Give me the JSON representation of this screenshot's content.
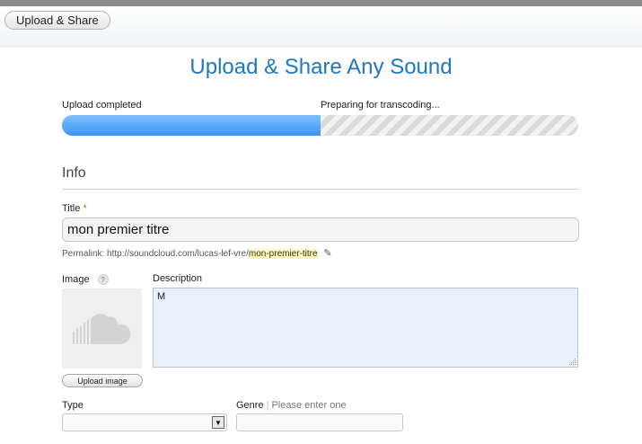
{
  "tab": {
    "label": "Upload & Share"
  },
  "page": {
    "title": "Upload & Share Any Sound"
  },
  "progress": {
    "left_label": "Upload completed",
    "right_label": "Preparing for transcoding...",
    "fraction": 0.5
  },
  "info": {
    "heading": "Info",
    "title_label": "Title",
    "required_mark": "*",
    "title_value": "mon premier titre",
    "permalink_label": "Permalink:",
    "permalink_base": "http://soundcloud.com/lucas-lef-vre/",
    "permalink_slug": "mon-premier-titre"
  },
  "image": {
    "label": "Image",
    "help": "?",
    "upload_button": "Upload image",
    "placeholder_icon": "soundcloud-cloud-icon"
  },
  "description": {
    "label": "Description",
    "value": "M"
  },
  "type": {
    "label": "Type",
    "value": ""
  },
  "genre": {
    "label": "Genre",
    "hint": "Please enter one",
    "value": ""
  },
  "colors": {
    "accent": "#1f78c4",
    "progress_fill": "#3a96f0",
    "required": "#e05a00",
    "slug_highlight": "#fff6b8"
  }
}
